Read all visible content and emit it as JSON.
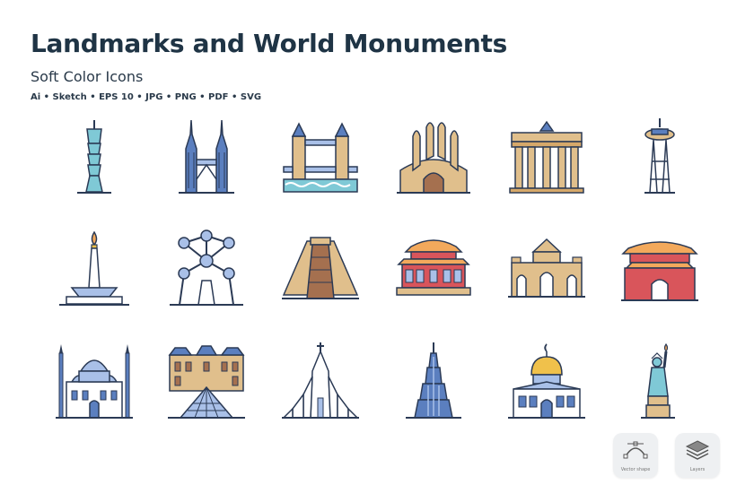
{
  "header": {
    "title": "Landmarks and World Monuments",
    "subtitle": "Soft Color Icons",
    "formats": "Ai • Sketch • EPS 10 • JPG • PNG • PDF • SVG"
  },
  "colors": {
    "outline": "#2b3a55",
    "blue": "#5b7fbf",
    "light_blue": "#a9c0e8",
    "tan": "#e0bf8c",
    "brown": "#a5704f",
    "red": "#d9555b",
    "orange": "#f3a95c",
    "gold": "#f0c14b",
    "teal": "#7fc9d6"
  },
  "icons": [
    {
      "name": "taipei-101-icon"
    },
    {
      "name": "petronas-towers-icon"
    },
    {
      "name": "tower-bridge-icon"
    },
    {
      "name": "sagrada-familia-icon"
    },
    {
      "name": "brandenburg-gate-icon"
    },
    {
      "name": "space-needle-icon"
    },
    {
      "name": "national-monument-icon"
    },
    {
      "name": "atomium-icon"
    },
    {
      "name": "pyramid-icon"
    },
    {
      "name": "forbidden-city-icon"
    },
    {
      "name": "puerta-de-alcala-icon"
    },
    {
      "name": "tiananmen-icon"
    },
    {
      "name": "blue-mosque-icon"
    },
    {
      "name": "louvre-icon"
    },
    {
      "name": "hallgrimskirkja-icon"
    },
    {
      "name": "burj-khalifa-icon"
    },
    {
      "name": "dome-of-the-rock-icon"
    },
    {
      "name": "statue-of-liberty-icon"
    }
  ],
  "badges": [
    {
      "label": "Vector shape",
      "icon": "vector-shape-icon"
    },
    {
      "label": "Layers",
      "icon": "layers-icon"
    }
  ]
}
